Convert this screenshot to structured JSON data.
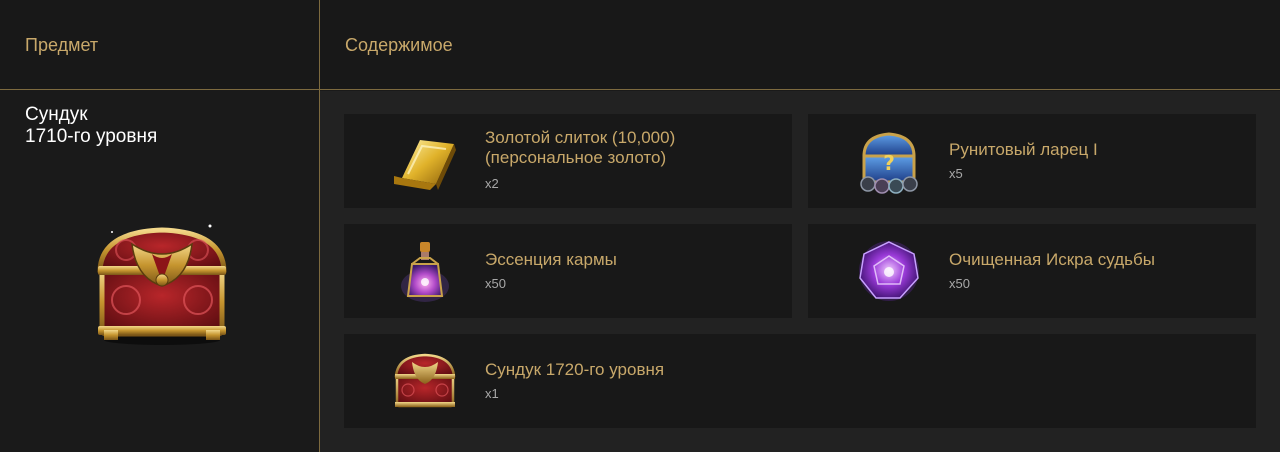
{
  "header": {
    "item_label": "Предмет",
    "contents_label": "Содержимое"
  },
  "chest": {
    "title_line1": "Сундук",
    "title_line2": "1710-го уровня"
  },
  "contents": [
    {
      "name_line1": "Золотой слиток (10,000)",
      "name_line2": "(персональное золото)",
      "qty": "x2",
      "icon": "gold-bar-icon"
    },
    {
      "name_line1": "Рунитовый ларец I",
      "name_line2": "",
      "qty": "x5",
      "icon": "runite-chest-icon"
    },
    {
      "name_line1": "Эссенция кармы",
      "name_line2": "",
      "qty": "x50",
      "icon": "karma-potion-icon"
    },
    {
      "name_line1": "Очищенная Искра судьбы",
      "name_line2": "",
      "qty": "x50",
      "icon": "destiny-spark-icon"
    },
    {
      "name_line1": "Сундук 1720-го уровня",
      "name_line2": "",
      "qty": "x1",
      "icon": "chest-icon"
    }
  ],
  "colors": {
    "gold_text": "#c8a86a",
    "divider": "#7d6a3f",
    "card_bg": "#181818",
    "panel_bg": "#222222"
  }
}
